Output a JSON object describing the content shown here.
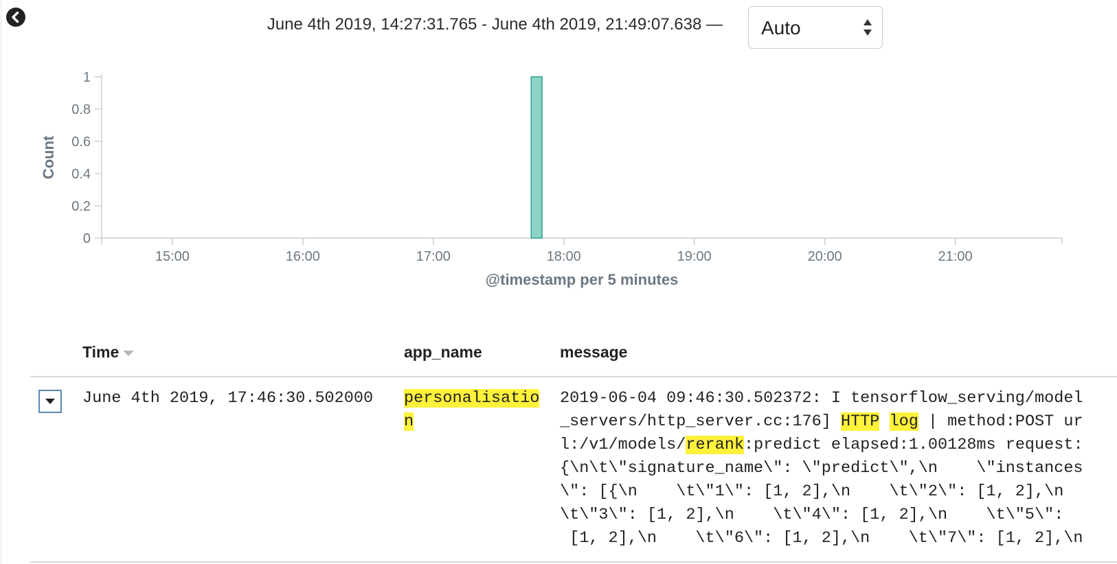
{
  "header": {
    "time_range": "June 4th 2019, 14:27:31.765 - June 4th 2019, 21:49:07.638 —",
    "interval": {
      "selected": "Auto"
    }
  },
  "chart_data": {
    "type": "bar",
    "ylabel": "Count",
    "xlabel": "@timestamp per 5 minutes",
    "ylim": [
      0,
      1
    ],
    "yticks": [
      "0",
      "0.2",
      "0.4",
      "0.6",
      "0.8",
      "1"
    ],
    "xticks": [
      "15:00",
      "16:00",
      "17:00",
      "18:00",
      "19:00",
      "20:00",
      "21:00"
    ],
    "xlim_minutes": [
      867.5,
      1309.1
    ],
    "bar_color": "#8fd3c8",
    "bar_stroke": "#2a9f8c",
    "bars": [
      {
        "x": "17:45",
        "start_minutes": 1065,
        "width_minutes": 5,
        "value": 1
      }
    ]
  },
  "table": {
    "columns": {
      "time": "Time",
      "app_name": "app_name",
      "message": "message"
    },
    "rows": [
      {
        "time": "June 4th 2019, 17:46:30.502000",
        "app_name": "personalisation",
        "message": {
          "l1": "2019-06-04 09:46:30.502372: I tensorflow_serving/model",
          "l2a": "_servers/http_server.cc:176] ",
          "l2_hl1": "HTTP",
          "l2_sp": " ",
          "l2_hl2": "log",
          "l2b": " | method:POST ur",
          "l3a": "l:/v1/models/",
          "l3_hl": "rerank",
          "l3b": ":predict elapsed:1.00128ms request:",
          "l4": "{\\n\\t\\\"signature_name\\\": \\\"predict\\\",\\n    \\\"instances",
          "l5": "\\\": [{\\n    \\t\\\"1\\\": [1, 2],\\n    \\t\\\"2\\\": [1, 2],\\n",
          "l6": "\\t\\\"3\\\": [1, 2],\\n    \\t\\\"4\\\": [1, 2],\\n    \\t\\\"5\\\":",
          "l7": " [1, 2],\\n    \\t\\\"6\\\": [1, 2],\\n    \\t\\\"7\\\": [1, 2],\\n"
        }
      }
    ]
  },
  "colors": {
    "highlight": "#fff23b",
    "toggle_border": "#5b87b4"
  },
  "icons": {
    "back": "chevron-left-circle-icon",
    "toggle": "caret-down-icon",
    "select": "up-down-arrows-icon"
  }
}
